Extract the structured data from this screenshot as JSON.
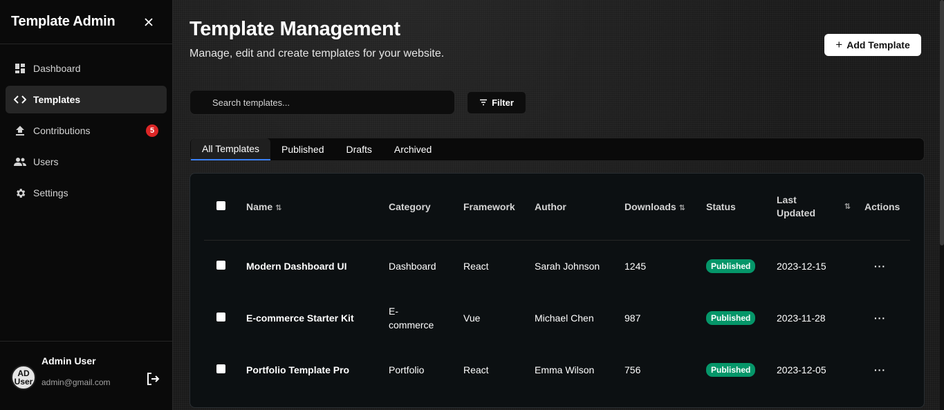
{
  "sidebar": {
    "title": "Template Admin",
    "items": [
      {
        "label": "Dashboard",
        "icon": "dashboard-icon"
      },
      {
        "label": "Templates",
        "icon": "code-icon"
      },
      {
        "label": "Contributions",
        "icon": "upload-icon",
        "badge": "5"
      },
      {
        "label": "Users",
        "icon": "users-icon"
      },
      {
        "label": "Settings",
        "icon": "gear-icon"
      }
    ],
    "user": {
      "name": "Admin User",
      "email": "admin@gmail.com",
      "avatar_text": "AD User"
    }
  },
  "header": {
    "title": "Template Management",
    "subtitle": "Manage, edit and create templates for your website.",
    "add_label": "Add Template"
  },
  "toolbar": {
    "search_placeholder": "Search templates...",
    "filter_label": "Filter"
  },
  "tabs": [
    "All Templates",
    "Published",
    "Drafts",
    "Archived"
  ],
  "table": {
    "columns": [
      "Name",
      "Category",
      "Framework",
      "Author",
      "Downloads",
      "Status",
      "Last Updated",
      "Actions"
    ],
    "rows": [
      {
        "name": "Modern Dashboard UI",
        "category": "Dashboard",
        "framework": "React",
        "author": "Sarah Johnson",
        "downloads": "1245",
        "status": "Published",
        "updated": "2023-12-15",
        "actions": "···"
      },
      {
        "name": "E-commerce Starter Kit",
        "category": "E-commerce",
        "framework": "Vue",
        "author": "Michael Chen",
        "downloads": "987",
        "status": "Published",
        "updated": "2023-11-28",
        "actions": "···"
      },
      {
        "name": "Portfolio Template Pro",
        "category": "Portfolio",
        "framework": "React",
        "author": "Emma Wilson",
        "downloads": "756",
        "status": "Published",
        "updated": "2023-12-05",
        "actions": "···"
      }
    ]
  },
  "colors": {
    "accent_tab": "#3b82f6",
    "status_published": "#059669",
    "badge_red": "#dc2626"
  }
}
